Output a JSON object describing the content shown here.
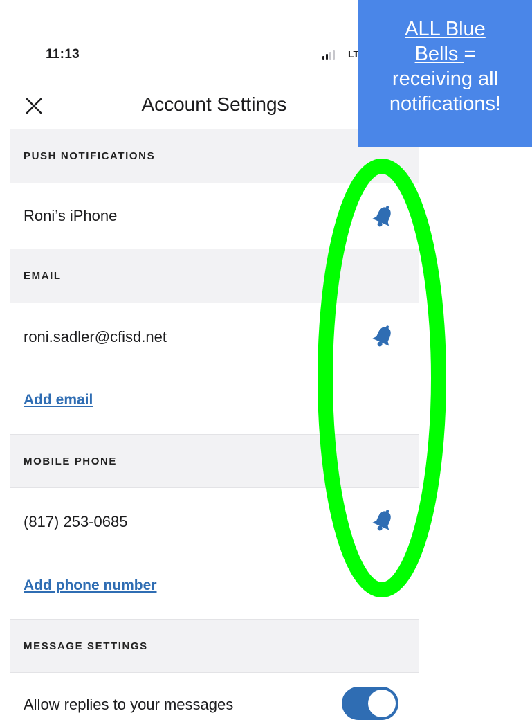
{
  "status_bar": {
    "time": "11:13",
    "network": "LT"
  },
  "header": {
    "title": "Account Settings",
    "close_icon": "close-x-icon"
  },
  "sections": {
    "push": {
      "header": "PUSH NOTIFICATIONS",
      "device": "Roni’s iPhone",
      "bell_icon": "bell-icon"
    },
    "email": {
      "header": "EMAIL",
      "address": "roni.sadler@cfisd.net",
      "add_link": "Add email",
      "bell_icon": "bell-icon"
    },
    "mobile": {
      "header": "MOBILE PHONE",
      "number": "(817) 253-0685",
      "add_link": "Add phone number",
      "bell_icon": "bell-icon"
    },
    "messages": {
      "header": "MESSAGE SETTINGS",
      "allow_replies_label": "Allow replies to your messages",
      "allow_replies_on": true
    }
  },
  "annotation": {
    "callout_line1": "ALL Blue",
    "callout_line2_underlined": "Bells ",
    "callout_line2_rest": "=",
    "callout_line3": "receiving all",
    "callout_line4": "notifications!",
    "callout_color": "#4a86e8",
    "oval_color": "#00ff00"
  },
  "colors": {
    "accent": "#2f6db3",
    "section_bg": "#f2f2f4"
  }
}
